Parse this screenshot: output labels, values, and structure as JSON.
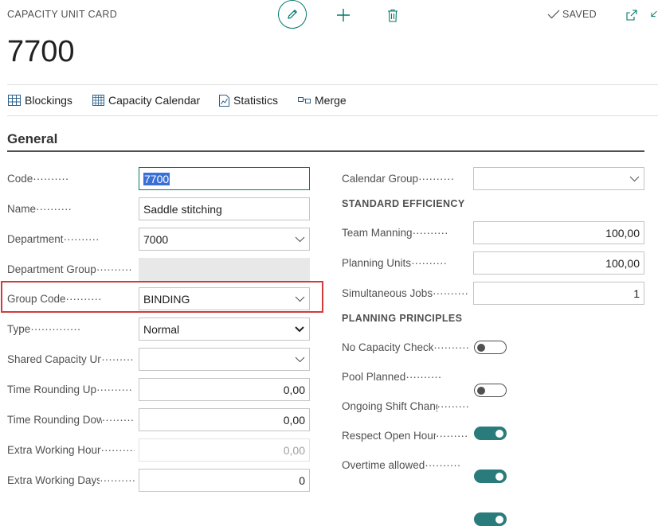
{
  "header": {
    "card_title": "CAPACITY UNIT CARD",
    "saved_label": "SAVED",
    "record_no": "7700"
  },
  "actions": [
    {
      "label": "Blockings",
      "icon": "blockings-grid-icon"
    },
    {
      "label": "Capacity Calendar",
      "icon": "calendar-grid-icon"
    },
    {
      "label": "Statistics",
      "icon": "statistics-chart-icon"
    },
    {
      "label": "Merge",
      "icon": "merge-icon"
    }
  ],
  "section": {
    "title": "General"
  },
  "left_fields": {
    "code": {
      "label": "Code",
      "value": "7700"
    },
    "name": {
      "label": "Name",
      "value": "Saddle stitching"
    },
    "department": {
      "label": "Department",
      "value": "7000"
    },
    "department_group": {
      "label": "Department Group",
      "value": ""
    },
    "group_code": {
      "label": "Group Code",
      "value": "BINDING"
    },
    "type": {
      "label": "Type",
      "value": "Normal"
    },
    "shared_capacity_unit": {
      "label": "Shared Capacity Unit",
      "value": ""
    },
    "time_rounding_up": {
      "label": "Time Rounding Up",
      "value": "0,00"
    },
    "time_rounding_down": {
      "label": "Time Rounding Down",
      "value": "0,00"
    },
    "extra_working_hours": {
      "label": "Extra Working Hours",
      "value": "0,00"
    },
    "extra_working_days": {
      "label": "Extra Working Days",
      "value": "0"
    }
  },
  "right_fields": {
    "calendar_group": {
      "label": "Calendar Group",
      "value": ""
    },
    "standard_efficiency_title": "STANDARD EFFICIENCY",
    "team_manning": {
      "label": "Team Manning",
      "value": "100,00"
    },
    "planning_units": {
      "label": "Planning Units",
      "value": "100,00"
    },
    "simultaneous_jobs": {
      "label": "Simultaneous Jobs",
      "value": "1"
    },
    "planning_principles_title": "PLANNING PRINCIPLES",
    "no_capacity_check": {
      "label": "No Capacity Check",
      "on": false
    },
    "pool_planned": {
      "label": "Pool Planned",
      "on": false
    },
    "ongoing_shift_change": {
      "label": "Ongoing Shift Change",
      "on": true
    },
    "respect_open_hours": {
      "label": "Respect Open Hours",
      "on": true
    },
    "overtime_allowed": {
      "label": "Overtime allowed",
      "on": true
    }
  },
  "colors": {
    "accent": "#00796b",
    "toggle_on": "#2a7b7b",
    "highlight": "#d23b3b"
  }
}
